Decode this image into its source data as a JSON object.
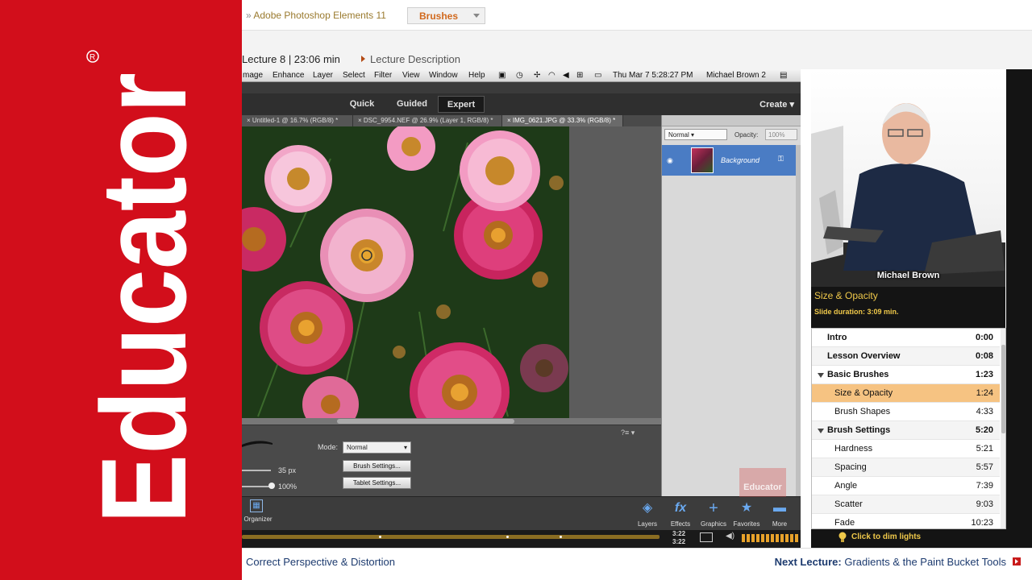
{
  "brand": {
    "logo_text": "Educator",
    "registered_mark": "®"
  },
  "breadcrumb": {
    "sep": "»",
    "course": "Adobe Photoshop Elements 11",
    "current": "Brushes"
  },
  "lecture": {
    "info": "Lecture 8 | 23:06 min",
    "description_link": "Lecture Description"
  },
  "mac_menu": {
    "items": [
      "mage",
      "Enhance",
      "Layer",
      "Select",
      "Filter",
      "View",
      "Window",
      "Help"
    ],
    "clock": "Thu Mar 7  5:28:27 PM",
    "user": "Michael Brown 2"
  },
  "ps": {
    "modes": [
      "Quick",
      "Guided",
      "Expert"
    ],
    "active_mode": "Expert",
    "create_label": "Create",
    "tabs": [
      "Untitled-1 @ 16.7% (RGB/8) *",
      "DSC_9954.NEF @ 26.9% (Layer 1, RGB/8) *",
      "IMG_0621.JPG @ 33.3% (RGB/8) *"
    ],
    "layers": {
      "blend_mode": "Normal",
      "opacity_label": "Opacity:",
      "opacity_value": "100%",
      "layer_name": "Background"
    },
    "tool_options": {
      "mode_label": "Mode:",
      "mode_value": "Normal",
      "size_value": "35 px",
      "opacity_value": "100%",
      "brush_settings": "Brush Settings...",
      "tablet_settings": "Tablet Settings..."
    },
    "taskbar": {
      "organizer": "Organizer",
      "items": [
        "Layers",
        "Effects",
        "Graphics",
        "Favorites",
        "More"
      ]
    },
    "player": {
      "current": "3:22",
      "total": "3:22",
      "watermark": "Educator"
    }
  },
  "presenter": {
    "name": "Michael Brown"
  },
  "slide": {
    "title": "Size & Opacity",
    "duration": "Slide duration: 3:09 min."
  },
  "toc": [
    {
      "title": "Intro",
      "time": "0:00",
      "bold": true
    },
    {
      "title": "Lesson Overview",
      "time": "0:08",
      "bold": true
    },
    {
      "title": "Basic Brushes",
      "time": "1:23",
      "bold": true,
      "caret": true
    },
    {
      "title": "Size & Opacity",
      "time": "1:24",
      "active": true
    },
    {
      "title": "Brush Shapes",
      "time": "4:33"
    },
    {
      "title": "Brush Settings",
      "time": "5:20",
      "bold": true,
      "caret": true
    },
    {
      "title": "Hardness",
      "time": "5:21"
    },
    {
      "title": "Spacing",
      "time": "5:57"
    },
    {
      "title": "Angle",
      "time": "7:39"
    },
    {
      "title": "Scatter",
      "time": "9:03"
    },
    {
      "title": "Fade",
      "time": "10:23"
    }
  ],
  "dim_lights": "Click to dim lights",
  "nav": {
    "prev": "Correct Perspective & Distortion",
    "next_label": "Next Lecture:",
    "next_title": "Gradients & the Paint Bucket Tools"
  },
  "colors": {
    "brand_red": "#d20e1b",
    "accent_yellow": "#f0c94a",
    "toc_active": "#f6c382",
    "link_navy": "#1d3b6f"
  }
}
